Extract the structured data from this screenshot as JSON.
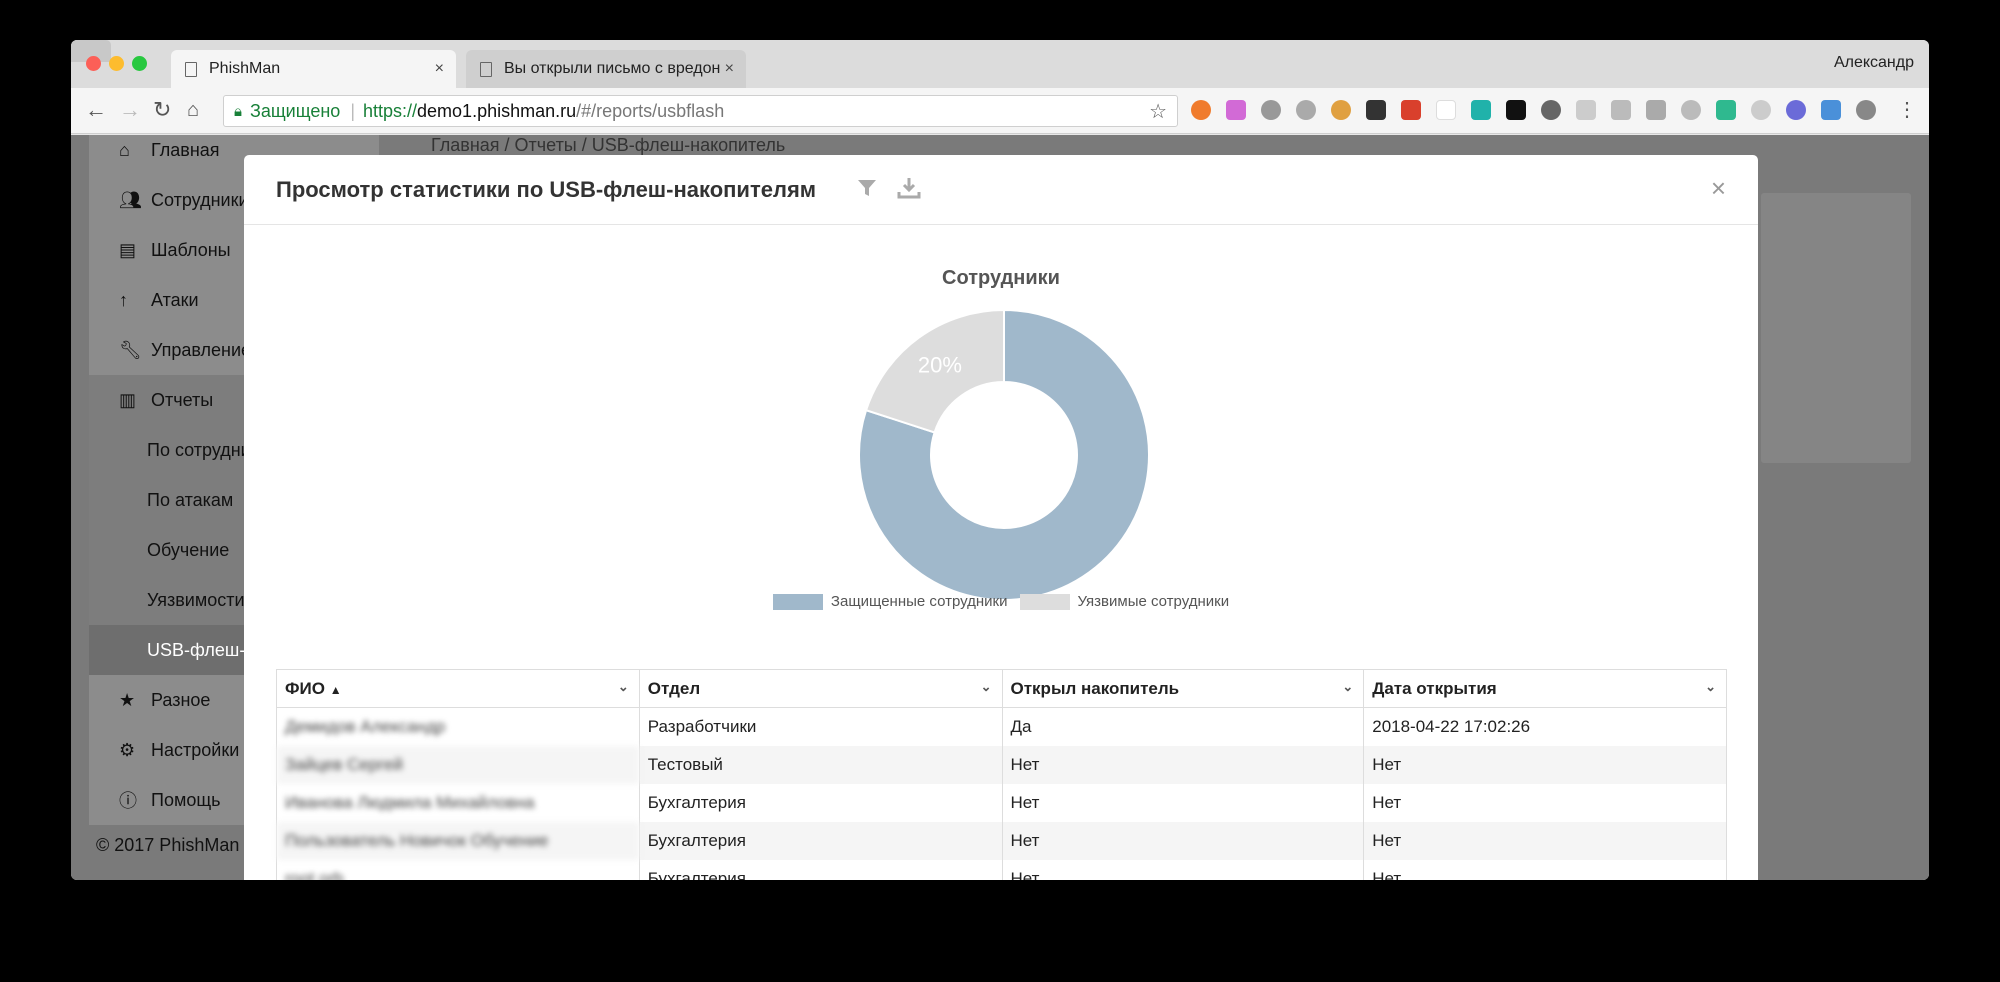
{
  "browser": {
    "tabs": [
      {
        "label": "PhishMan",
        "close": "×"
      },
      {
        "label": "Вы открыли письмо с вредон",
        "close": "×"
      }
    ],
    "user": "Александр",
    "omnibox": {
      "secure_label": "Защищено",
      "url_proto": "https://",
      "url_host": "demo1.phishman.ru",
      "url_path": "/#/reports/usbflash"
    }
  },
  "page": {
    "breadcrumb": [
      "Главная",
      "Отчеты",
      "USB-флеш-накопитель"
    ],
    "sidebar": [
      {
        "label": "Главная",
        "icon": "home-icon"
      },
      {
        "label": "Сотрудники",
        "icon": "people-icon"
      },
      {
        "label": "Шаблоны",
        "icon": "templates-icon"
      },
      {
        "label": "Атаки",
        "icon": "arrow-up-icon"
      },
      {
        "label": "Управление",
        "icon": "wrench-icon"
      },
      {
        "label": "Отчеты",
        "icon": "chart-icon"
      },
      {
        "label": "По сотрудникам"
      },
      {
        "label": "По атакам"
      },
      {
        "label": "Обучение"
      },
      {
        "label": "Уязвимости"
      },
      {
        "label": "USB-флеш-накопитель"
      },
      {
        "label": "Разное",
        "icon": "star-icon"
      },
      {
        "label": "Настройки",
        "icon": "gear-icon"
      },
      {
        "label": "Помощь",
        "icon": "info-icon"
      }
    ],
    "footer": "© 2017 PhishMan"
  },
  "modal": {
    "title": "Просмотр статистики по USB-флеш-накопителям",
    "close": "×"
  },
  "chart_data": {
    "type": "pie",
    "title": "Сотрудники",
    "categories": [
      "Защищенные сотрудники",
      "Уязвимые сотрудники"
    ],
    "values": [
      80,
      20
    ],
    "labels": [
      "80%",
      "20%"
    ],
    "colors": [
      "#a0b8cb",
      "#dddddd"
    ],
    "donut": true,
    "legend_position": "bottom"
  },
  "table": {
    "columns": [
      "ФИО",
      "Отдел",
      "Открыл накопитель",
      "Дата открытия"
    ],
    "sort_column": "ФИО",
    "rows": [
      [
        "Демидов Александр",
        "Разработчики",
        "Да",
        "2018-04-22 17:02:26"
      ],
      [
        "Зайцев Сергей",
        "Тестовый",
        "Нет",
        "Нет"
      ],
      [
        "Иванова Людмила Михайловна",
        "Бухгалтерия",
        "Нет",
        "Нет"
      ],
      [
        "Пользователь Новичок Обучение",
        "Бухгалтерия",
        "Нет",
        "Нет"
      ],
      [
        "root orb",
        "Бухгалтерия",
        "Нет",
        "Нет"
      ]
    ]
  }
}
